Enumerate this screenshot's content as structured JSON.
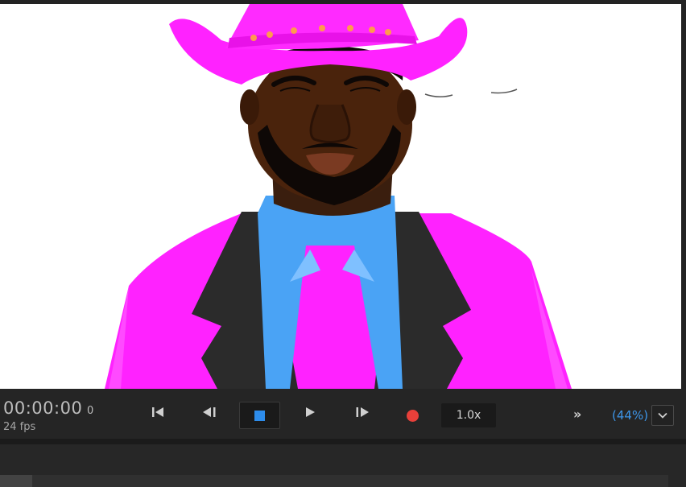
{
  "transport": {
    "timecode": "00:00:00",
    "frame": "0",
    "fps": "24 fps",
    "speed": "1.0x",
    "more_label": "»",
    "zoom": "(44%)"
  },
  "icons": {
    "first_frame": "skip-to-start-icon",
    "prev_frame": "step-back-icon",
    "stop": "stop-icon",
    "play": "play-icon",
    "next_frame": "step-forward-icon",
    "record": "record-icon",
    "more": "chevron-double-right-icon",
    "zoom_dropdown": "chevron-down-icon"
  },
  "colors": {
    "accent_blue": "#2d8ceb",
    "record_red": "#e8403a",
    "zoom_blue": "#3d95e8",
    "suit_magenta": "#ff22ff",
    "shirt_blue": "#4aa3f5"
  }
}
